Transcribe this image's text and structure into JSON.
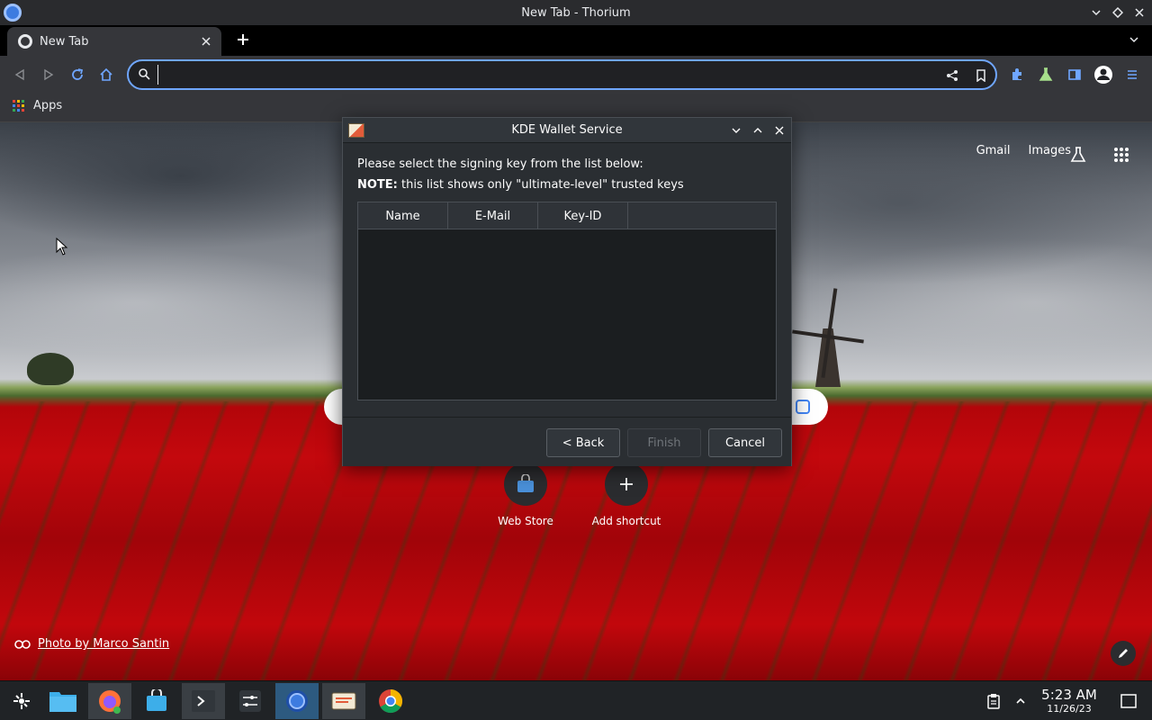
{
  "window": {
    "title": "New Tab - Thorium"
  },
  "tabs": [
    {
      "label": "New Tab"
    }
  ],
  "toolbar": {
    "address_value": "",
    "address_placeholder": ""
  },
  "bookmarks": {
    "apps_label": "Apps"
  },
  "ntp": {
    "links": [
      "Gmail",
      "Images"
    ],
    "shortcuts": [
      {
        "label": "Web Store"
      },
      {
        "label": "Add shortcut"
      }
    ],
    "photo_credit": "Photo by Marco Santin"
  },
  "dialog": {
    "title": "KDE Wallet Service",
    "prompt": "Please select the signing key from the list below:",
    "note_label": "NOTE:",
    "note_text": " this list shows only \"ultimate-level\" trusted keys",
    "columns": [
      "Name",
      "E-Mail",
      "Key-ID"
    ],
    "buttons": {
      "back": "< Back",
      "finish": "Finish",
      "cancel": "Cancel"
    }
  },
  "taskbar": {
    "time": "5:23 AM",
    "date": "11/26/23"
  },
  "colors": {
    "accent": "#6fa6ff",
    "dialog_bg": "#2a2e32",
    "taskbar_bg": "#202326"
  }
}
